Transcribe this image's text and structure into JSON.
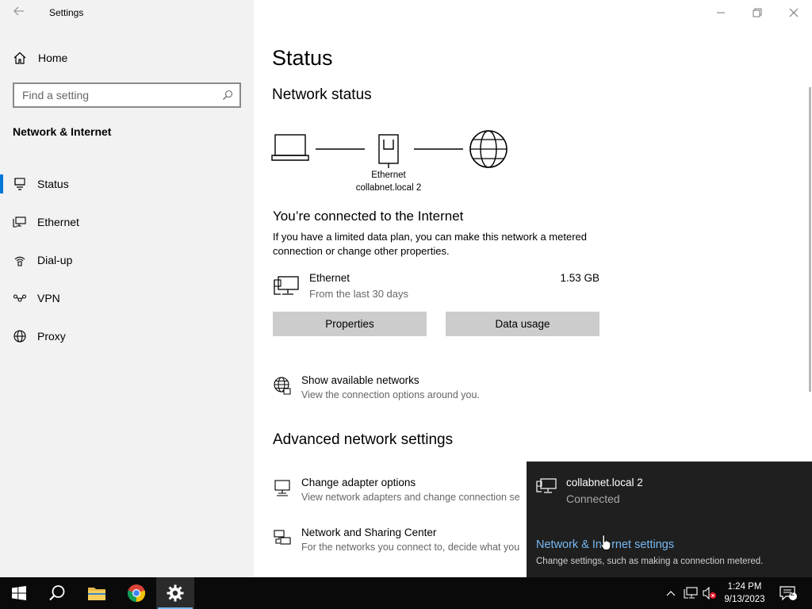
{
  "app": {
    "title": "Settings"
  },
  "sidebar": {
    "home_label": "Home",
    "search_placeholder": "Find a setting",
    "section_label": "Network & Internet",
    "items": [
      {
        "label": "Status",
        "icon": "status-icon",
        "active": true
      },
      {
        "label": "Ethernet",
        "icon": "ethernet-icon",
        "active": false
      },
      {
        "label": "Dial-up",
        "icon": "dial-up-icon",
        "active": false
      },
      {
        "label": "VPN",
        "icon": "vpn-icon",
        "active": false
      },
      {
        "label": "Proxy",
        "icon": "proxy-icon",
        "active": false
      }
    ]
  },
  "main": {
    "title": "Status",
    "network_status_title": "Network status",
    "diagram": {
      "adapter_name": "Ethernet",
      "network_name": "collabnet.local 2"
    },
    "connected_title": "You’re connected to the Internet",
    "connected_desc": "If you have a limited data plan, you can make this network a metered connection or change other properties.",
    "ethernet": {
      "name": "Ethernet",
      "subtitle": "From the last 30 days",
      "usage": "1.53 GB"
    },
    "buttons": {
      "properties": "Properties",
      "data_usage": "Data usage"
    },
    "show_networks": {
      "title": "Show available networks",
      "desc": "View the connection options around you."
    },
    "advanced_title": "Advanced network settings",
    "adapter_options": {
      "title": "Change adapter options",
      "desc": "View network adapters and change connection se"
    },
    "sharing_center": {
      "title": "Network and Sharing Center",
      "desc": "For the networks you connect to, decide what you"
    }
  },
  "flyout": {
    "network_name": "collabnet.local 2",
    "network_status": "Connected",
    "settings_link": "Network & Internet settings",
    "settings_desc": "Change settings, such as making a connection metered."
  },
  "taskbar": {
    "time": "1:24 PM",
    "date": "9/13/2023",
    "notification_count": "2"
  },
  "colors": {
    "accent": "#0078d7",
    "sidebar_bg": "#f2f2f2",
    "flyout_bg": "#1f1f1f",
    "link_color": "#77b9f2",
    "taskbar_bg": "#0a0a0a"
  }
}
